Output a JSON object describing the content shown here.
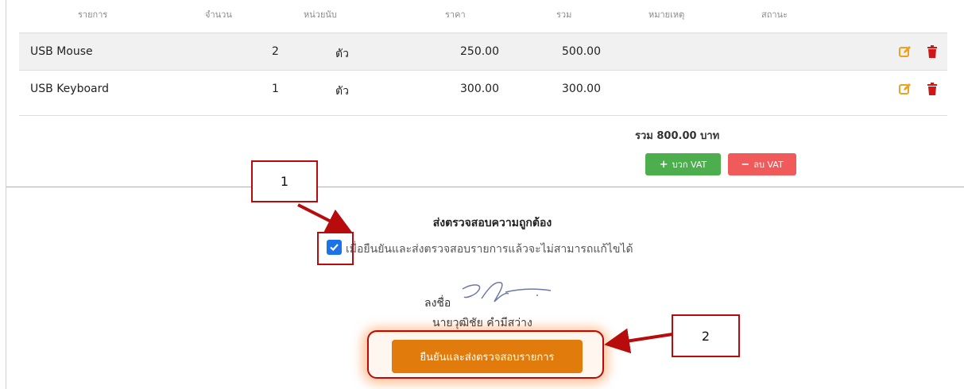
{
  "table": {
    "headers": [
      "รายการ",
      "จำนวน",
      "หน่วยนับ",
      "ราคา",
      "รวม",
      "หมายเหตุ",
      "สถานะ"
    ],
    "rows": [
      {
        "name": "USB Mouse",
        "qty": "2",
        "unit": "ตัว",
        "price": "250.00",
        "total": "500.00",
        "note": "",
        "status": ""
      },
      {
        "name": "USB Keyboard",
        "qty": "1",
        "unit": "ตัว",
        "price": "300.00",
        "total": "300.00",
        "note": "",
        "status": ""
      }
    ],
    "edit_icon": "edit-icon",
    "delete_icon": "trash-icon"
  },
  "summary": {
    "total_text": "รวม 800.00 บาท",
    "add_vat_label": "บวก VAT",
    "remove_vat_label": "ลบ VAT"
  },
  "confirm_section": {
    "title": "ส่งตรวจสอบความถูกต้อง",
    "checkbox_checked": true,
    "checkbox_label": "เมื่อยืนยันและส่งตรวจสอบรายการแล้วจะไม่สามารถแก้ไขได้",
    "signature_label": "ลงชื่อ",
    "signer_name": "นายวุฒิชัย คำมีสว่าง",
    "confirm_button_label": "ยืนยันและส่งตรวจสอบรายการ"
  },
  "annotations": {
    "callout_1": "1",
    "callout_2": "2"
  },
  "colors": {
    "edit_icon": "#f0a020",
    "delete_icon": "#d01717",
    "add_vat_button": "#4cae4c",
    "remove_vat_button": "#f05a5a",
    "confirm_button": "#e07b0c",
    "checkbox": "#1a73e8",
    "annotation": "#b80c0c"
  }
}
